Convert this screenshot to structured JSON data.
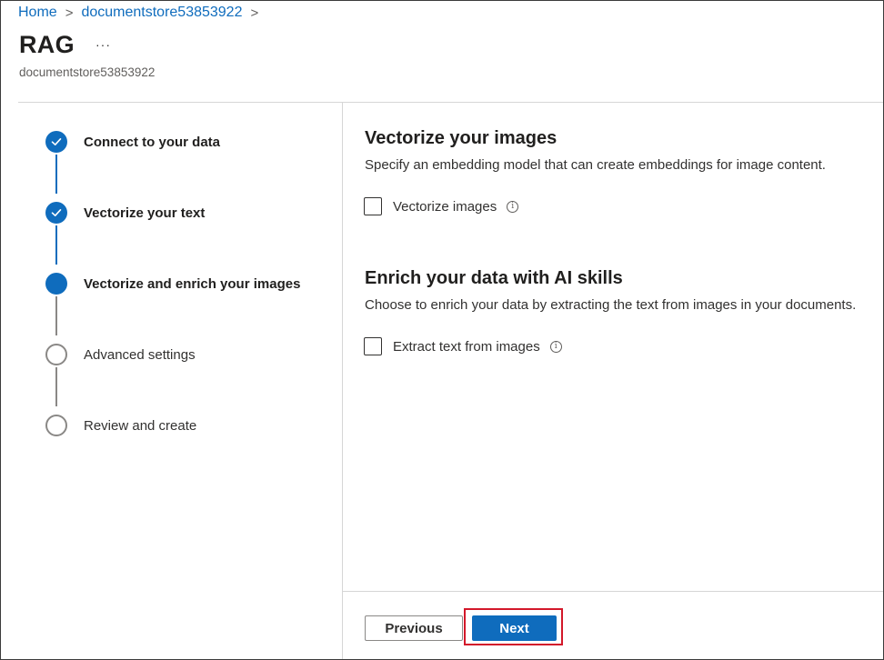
{
  "breadcrumb": {
    "items": [
      "Home",
      "documentstore53853922"
    ],
    "separator": ">"
  },
  "header": {
    "title": "RAG",
    "more_label": "···",
    "subtitle": "documentstore53853922"
  },
  "steps": [
    {
      "label": "Connect to your data",
      "state": "done"
    },
    {
      "label": "Vectorize your text",
      "state": "done"
    },
    {
      "label": "Vectorize and enrich your images",
      "state": "current"
    },
    {
      "label": "Advanced settings",
      "state": "todo"
    },
    {
      "label": "Review and create",
      "state": "todo"
    }
  ],
  "vectorize": {
    "title": "Vectorize your images",
    "description": "Specify an embedding model that can create embeddings for image content.",
    "checkbox_label": "Vectorize images",
    "checked": false
  },
  "enrich": {
    "title": "Enrich your data with AI skills",
    "description": "Choose to enrich your data by extracting the text from images in your documents.",
    "checkbox_label": "Extract text from images",
    "checked": false
  },
  "footer": {
    "previous_label": "Previous",
    "next_label": "Next"
  },
  "colors": {
    "accent": "#0f6cbd",
    "highlight": "#d3182a"
  }
}
